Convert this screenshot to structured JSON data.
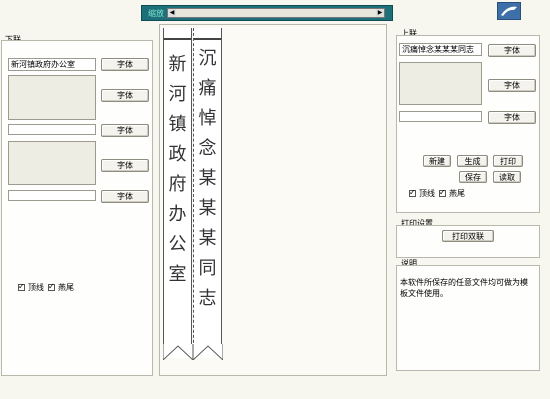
{
  "toolbar": {
    "zoom_label": "缩放",
    "left_arrow": "◀",
    "right_arrow": "▶"
  },
  "left_panel": {
    "title": "下联",
    "text_value": "新河镇政府办公室",
    "font_button": "字体",
    "checkboxes": [
      {
        "label": "顶线",
        "checked": true
      },
      {
        "label": "燕尾",
        "checked": true
      }
    ]
  },
  "couplet": {
    "left_scroll": [
      "新",
      "河",
      "镇",
      "政",
      "府",
      "办",
      "公",
      "室"
    ],
    "right_scroll": [
      "沉",
      "痛",
      "悼",
      "念",
      "某",
      "某",
      "某",
      "同",
      "志"
    ]
  },
  "right_panel": {
    "title": "上联",
    "text_value": "沉痛悼念某某某同志",
    "font_button": "字体",
    "buttons": {
      "new": "新建",
      "generate": "生成",
      "print": "打印",
      "save": "保存",
      "load": "读取"
    },
    "checkboxes": [
      {
        "label": "顶线",
        "checked": true
      },
      {
        "label": "燕尾",
        "checked": true
      }
    ]
  },
  "print_settings": {
    "title": "打印设置",
    "button": "打印双联"
  },
  "description": {
    "title": "说明",
    "text": "本软件所保存的任意文件均可做为模板文件使用。"
  },
  "colors": {
    "accent": "#1d6f7a",
    "logo_bg": "#3d6fa8"
  }
}
